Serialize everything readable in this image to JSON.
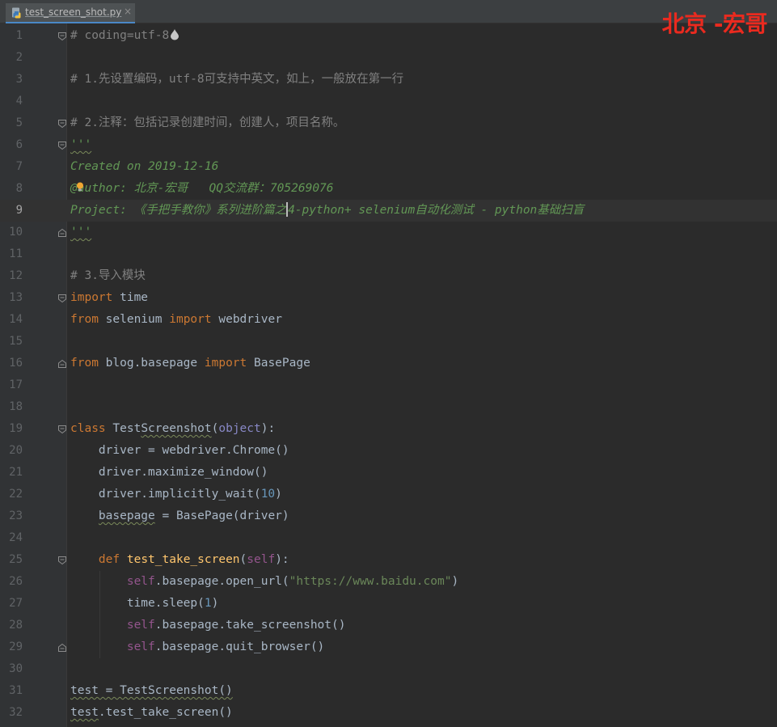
{
  "tab": {
    "filename": "test_screen_shot.py",
    "close": "×",
    "icon": "python-file-icon"
  },
  "watermark": "北京 -宏哥",
  "editor": {
    "current_line": 9,
    "lines": [
      {
        "n": "1",
        "fold": "start",
        "tokens": [
          {
            "t": "# coding=utf-8",
            "c": "cmt"
          }
        ]
      },
      {
        "n": "2",
        "tokens": []
      },
      {
        "n": "3",
        "tokens": [
          {
            "t": "# 1.先设置编码，utf-8可支持中英文，如上，一般放在第一行",
            "c": "cmt"
          }
        ]
      },
      {
        "n": "4",
        "tokens": []
      },
      {
        "n": "5",
        "fold": "start",
        "tokens": [
          {
            "t": "# 2.注释：包括记录创建时间，创建人，项目名称。",
            "c": "cmt"
          }
        ]
      },
      {
        "n": "6",
        "fold": "start",
        "tokens": [
          {
            "t": "'''",
            "c": "doc",
            "wavy": true
          }
        ]
      },
      {
        "n": "7",
        "tokens": [
          {
            "t": "Created on 2019-12-16",
            "c": "doc"
          }
        ]
      },
      {
        "n": "8",
        "tokens": [
          {
            "t": "@author: 北京-宏哥   QQ交流群：705269076",
            "c": "doc"
          }
        ]
      },
      {
        "n": "9",
        "tokens": [
          {
            "t": "Project: 《手把手教你》系列进阶篇之",
            "c": "doc"
          },
          {
            "t": "4-python+ selenium自动化测试 - python基础扫盲",
            "c": "doc"
          }
        ]
      },
      {
        "n": "10",
        "fold": "end",
        "tokens": [
          {
            "t": "'''",
            "c": "doc",
            "wavy": true
          }
        ]
      },
      {
        "n": "11",
        "tokens": []
      },
      {
        "n": "12",
        "tokens": [
          {
            "t": "# 3.导入模块",
            "c": "cmt"
          }
        ]
      },
      {
        "n": "13",
        "fold": "start",
        "tokens": [
          {
            "t": "import",
            "c": "kw"
          },
          {
            "t": " time",
            "c": "id"
          }
        ]
      },
      {
        "n": "14",
        "tokens": [
          {
            "t": "from",
            "c": "kw"
          },
          {
            "t": " selenium ",
            "c": "id"
          },
          {
            "t": "import",
            "c": "kw"
          },
          {
            "t": " webdriver",
            "c": "id"
          }
        ]
      },
      {
        "n": "15",
        "tokens": []
      },
      {
        "n": "16",
        "fold": "end",
        "tokens": [
          {
            "t": "from",
            "c": "kw"
          },
          {
            "t": " blog.basepage ",
            "c": "id"
          },
          {
            "t": "import",
            "c": "kw"
          },
          {
            "t": " BasePage",
            "c": "id"
          }
        ]
      },
      {
        "n": "17",
        "tokens": []
      },
      {
        "n": "18",
        "tokens": []
      },
      {
        "n": "19",
        "fold": "start",
        "tokens": [
          {
            "t": "class",
            "c": "kw"
          },
          {
            "t": " Test",
            "c": "id"
          },
          {
            "t": "Screenshot",
            "c": "id",
            "wavy": true
          },
          {
            "t": "(",
            "c": "id"
          },
          {
            "t": "object",
            "c": "bi"
          },
          {
            "t": "):",
            "c": "id"
          }
        ]
      },
      {
        "n": "20",
        "tokens": [
          {
            "t": "    driver = webdriver.Chrome()",
            "c": "id"
          }
        ]
      },
      {
        "n": "21",
        "tokens": [
          {
            "t": "    driver.maximize_window()",
            "c": "id"
          }
        ]
      },
      {
        "n": "22",
        "tokens": [
          {
            "t": "    driver.implicitly_wait(",
            "c": "id"
          },
          {
            "t": "10",
            "c": "num"
          },
          {
            "t": ")",
            "c": "id"
          }
        ]
      },
      {
        "n": "23",
        "tokens": [
          {
            "t": "    ",
            "c": "id"
          },
          {
            "t": "basepage",
            "c": "id",
            "wavy": true
          },
          {
            "t": " = BasePage(driver)",
            "c": "id"
          }
        ]
      },
      {
        "n": "24",
        "tokens": []
      },
      {
        "n": "25",
        "fold": "start",
        "tokens": [
          {
            "t": "    ",
            "c": "id"
          },
          {
            "t": "def",
            "c": "kw"
          },
          {
            "t": " ",
            "c": "id"
          },
          {
            "t": "test_take_screen",
            "c": "fn"
          },
          {
            "t": "(",
            "c": "id"
          },
          {
            "t": "self",
            "c": "self"
          },
          {
            "t": "):",
            "c": "id"
          }
        ]
      },
      {
        "n": "26",
        "tokens": [
          {
            "t": "        ",
            "c": "id"
          },
          {
            "t": "self",
            "c": "self"
          },
          {
            "t": ".basepage.open_url(",
            "c": "id"
          },
          {
            "t": "\"https://www.baidu.com\"",
            "c": "str"
          },
          {
            "t": ")",
            "c": "id"
          }
        ]
      },
      {
        "n": "27",
        "tokens": [
          {
            "t": "        time.sleep(",
            "c": "id"
          },
          {
            "t": "1",
            "c": "num"
          },
          {
            "t": ")",
            "c": "id"
          }
        ]
      },
      {
        "n": "28",
        "tokens": [
          {
            "t": "        ",
            "c": "id"
          },
          {
            "t": "self",
            "c": "self"
          },
          {
            "t": ".basepage.take_screenshot()",
            "c": "id"
          }
        ]
      },
      {
        "n": "29",
        "fold": "end",
        "tokens": [
          {
            "t": "        ",
            "c": "id"
          },
          {
            "t": "self",
            "c": "self"
          },
          {
            "t": ".basepage.quit_browser()",
            "c": "id"
          }
        ]
      },
      {
        "n": "30",
        "tokens": []
      },
      {
        "n": "31",
        "tokens": [
          {
            "t": "test = TestScreenshot()",
            "c": "id",
            "wavy": true
          }
        ]
      },
      {
        "n": "32",
        "tokens": [
          {
            "t": "test",
            "c": "id",
            "wavy": true
          },
          {
            "t": ".test_take_screen()",
            "c": "id"
          }
        ]
      }
    ]
  }
}
